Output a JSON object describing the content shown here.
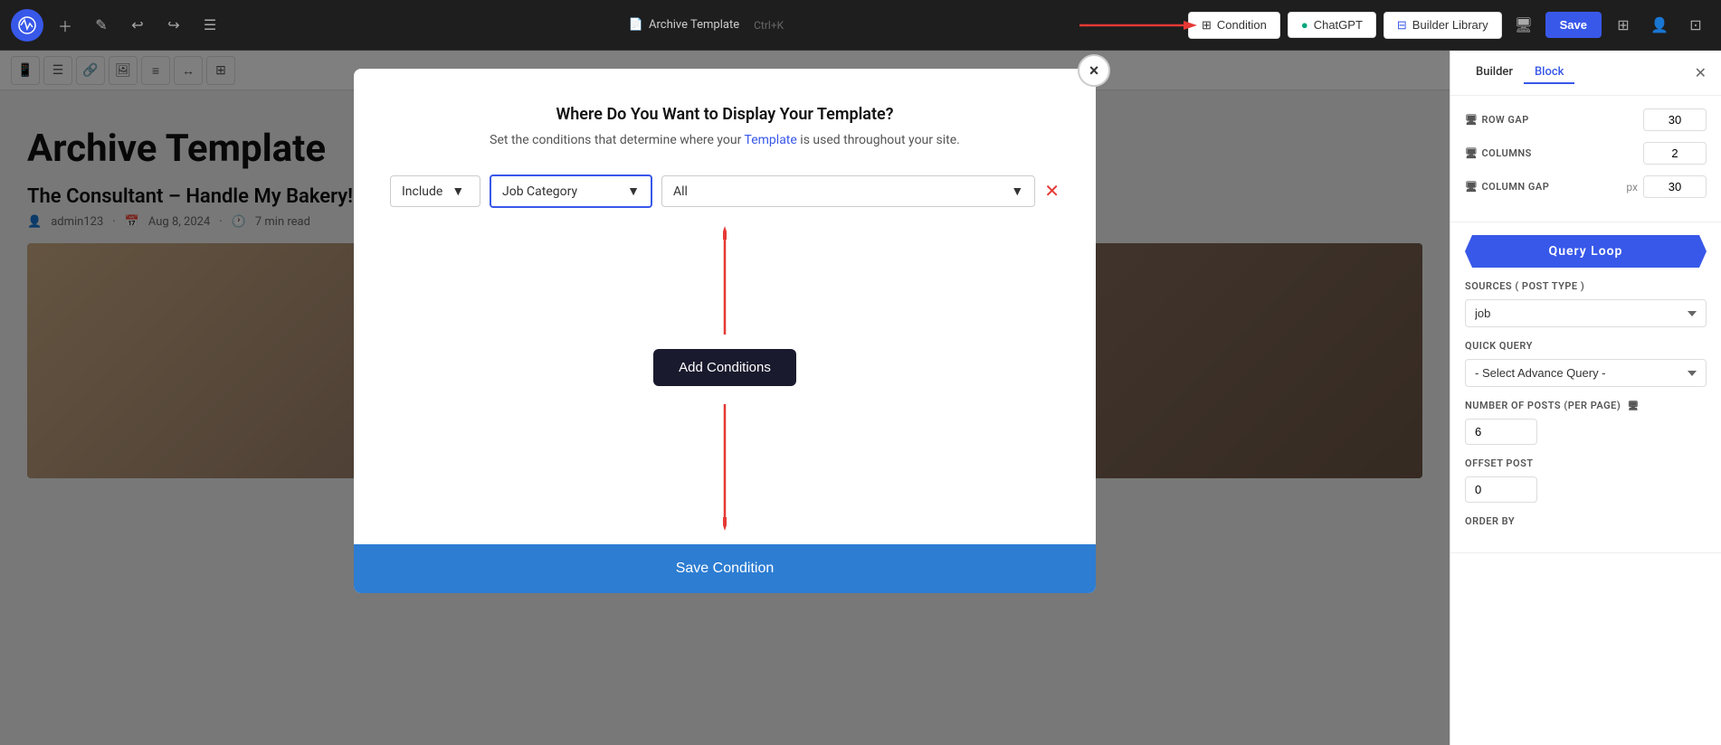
{
  "toolbar": {
    "wp_icon": "W",
    "archive_template_label": "Archive Template",
    "shortcut": "Ctrl+K",
    "condition_btn": "Condition",
    "chatgpt_btn": "ChatGPT",
    "builder_library_btn": "Builder Library",
    "save_btn": "Save"
  },
  "modal": {
    "title": "Where Do You Want to Display Your Template?",
    "subtitle_before": "Set the conditions that determine where your ",
    "subtitle_link": "Template",
    "subtitle_after": " is used throughout your site.",
    "close_icon": "×",
    "condition_row": {
      "include_label": "Include",
      "category_label": "Job Category",
      "all_label": "All"
    },
    "add_conditions_btn": "Add Conditions",
    "save_condition_btn": "Save Condition"
  },
  "right_sidebar": {
    "tab_builder": "Builder",
    "tab_block": "Block",
    "close_icon": "×",
    "row_gap_label": "ROW GAP",
    "row_gap_value": "30",
    "columns_label": "COLUMNS",
    "columns_value": "2",
    "column_gap_label": "COLUMN GAP",
    "column_gap_value": "30",
    "column_gap_unit": "px",
    "query_loop_label": "Query Loop",
    "sources_label": "SOURCES ( POST TYPE )",
    "sources_value": "job",
    "quick_query_label": "QUICK QUERY",
    "quick_query_placeholder": "- Select Advance Query -",
    "num_posts_label": "NUMBER OF POSTS (PER PAGE)",
    "num_posts_value": "6",
    "offset_post_label": "OFFSET POST",
    "offset_post_value": "0",
    "order_by_label": "ORDER BY"
  },
  "page_content": {
    "page_title": "Archive Template",
    "post_title": "The Consultant – Handle My Bakery!",
    "post_author": "admin123",
    "post_date": "Aug 8, 2024",
    "post_read": "7 min read"
  }
}
